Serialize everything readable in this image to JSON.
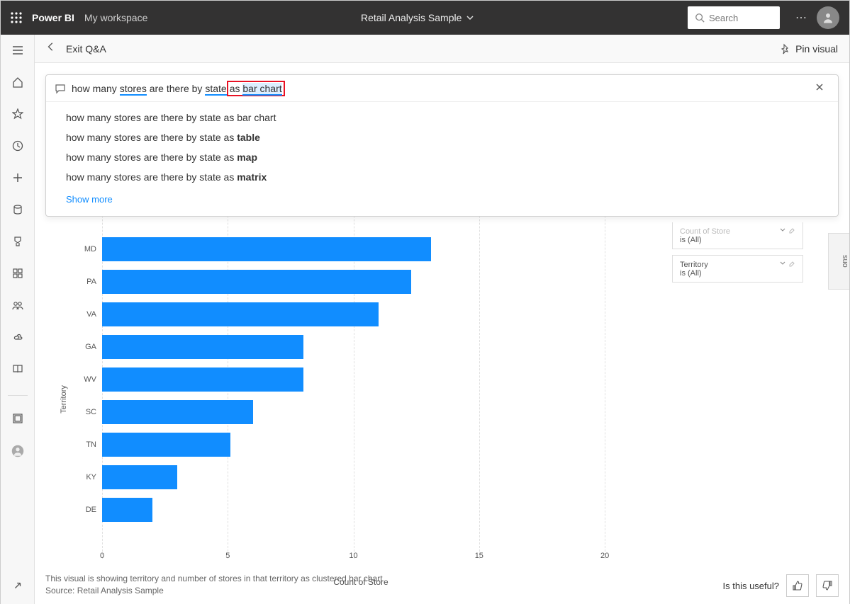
{
  "topbar": {
    "brand": "Power BI",
    "workspace": "My workspace",
    "report_title": "Retail Analysis Sample",
    "search_placeholder": "Search"
  },
  "subheader": {
    "exit_label": "Exit Q&A",
    "pin_label": "Pin visual"
  },
  "qna": {
    "query_prefix": "how many ",
    "query_stores": "stores",
    "query_mid": " are there by ",
    "query_state": "state",
    "query_bridge_as": " as ",
    "query_barchart": "bar chart",
    "suggestions": [
      {
        "pre": "how many stores are there by state as bar chart",
        "bold": ""
      },
      {
        "pre": "how many stores are there by state as ",
        "bold": "table"
      },
      {
        "pre": "how many stores are there by state as ",
        "bold": "map"
      },
      {
        "pre": "how many stores are there by state as ",
        "bold": "matrix"
      }
    ],
    "show_more": "Show more"
  },
  "chart_data": {
    "type": "bar",
    "orientation": "horizontal",
    "ylabel": "Territory",
    "xlabel": "Count of Store",
    "xlim": [
      0,
      22
    ],
    "xticks": [
      0,
      5,
      10,
      15,
      20
    ],
    "categories": [
      "MD",
      "PA",
      "VA",
      "GA",
      "WV",
      "SC",
      "TN",
      "KY",
      "DE"
    ],
    "values": [
      13.1,
      12.3,
      11.0,
      8.0,
      8.0,
      6.0,
      5.1,
      3.0,
      2.0
    ]
  },
  "filters": [
    {
      "title": "Count of Store",
      "value": "is (All)"
    },
    {
      "title": "Territory",
      "value": "is (All)"
    }
  ],
  "vis_tab": "Visualizations",
  "footer": {
    "line1": "This visual is showing territory and number of stores in that territory as clustered bar chart",
    "line2": "Source: Retail Analysis Sample"
  },
  "useful_prompt": "Is this useful?"
}
